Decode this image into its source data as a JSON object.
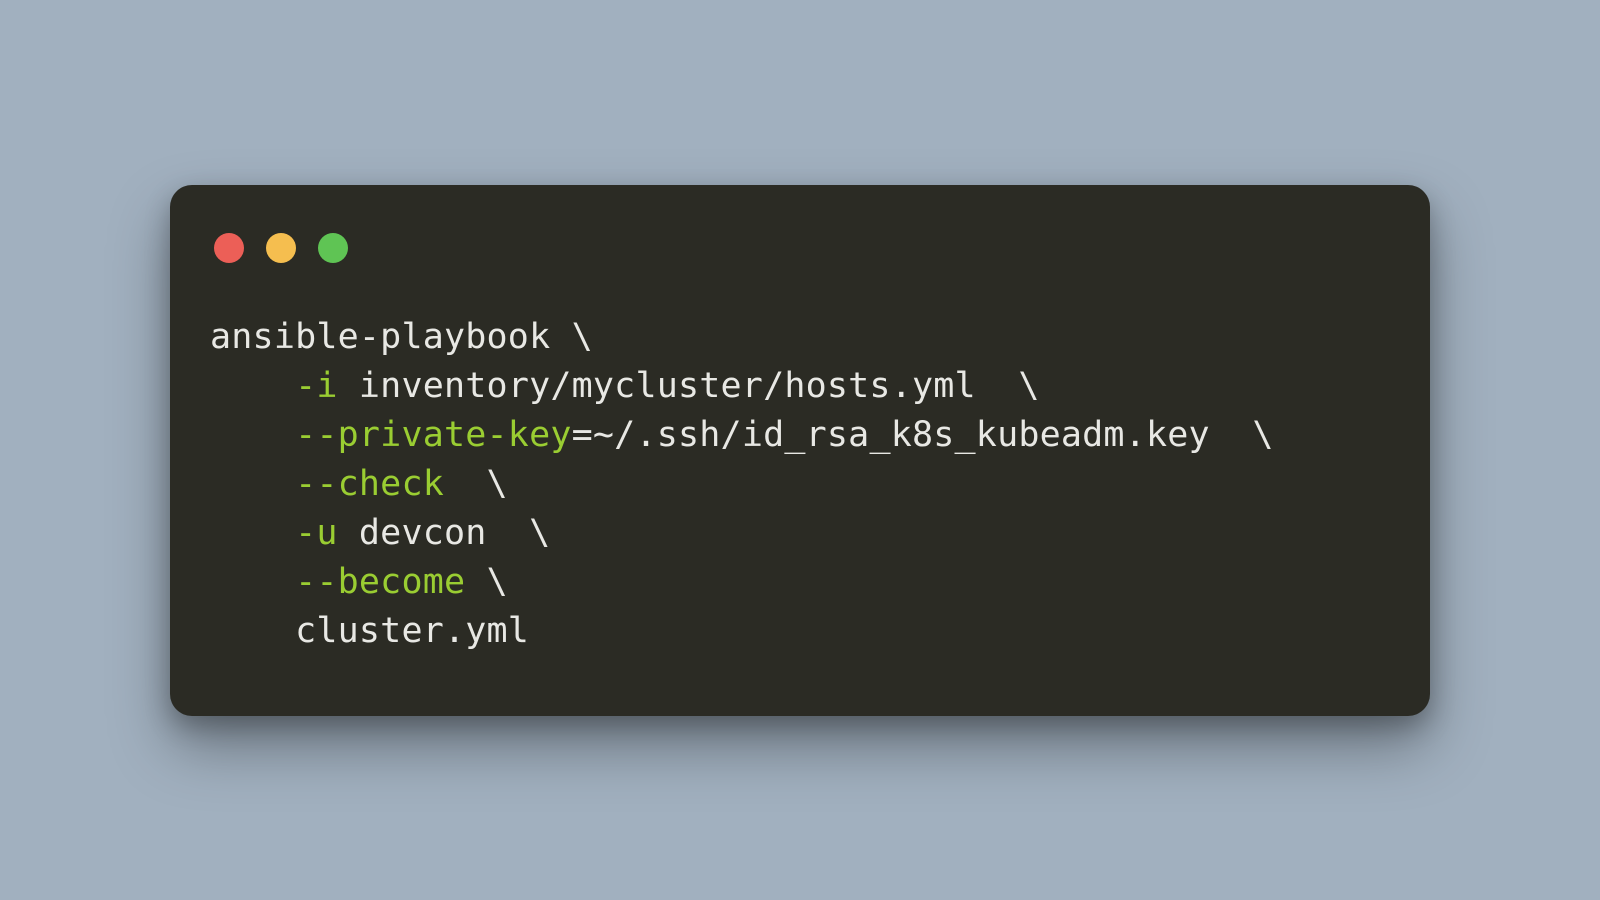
{
  "terminal": {
    "lines": {
      "l1_cmd": "ansible-playbook ",
      "cont": "\\",
      "indent": "    ",
      "l2_flag": "-i",
      "l2_rest": " inventory/mycluster/hosts.yml  ",
      "l3_flag": "--private-key",
      "l3_rest": "=~/.ssh/id_rsa_k8s_kubeadm.key  ",
      "l4_flag": "--check",
      "l4_rest": "  ",
      "l5_flag": "-u",
      "l5_rest": " devcon  ",
      "l6_flag": "--become",
      "l6_rest": " ",
      "l7": "cluster.yml"
    }
  },
  "colors": {
    "bg_page": "#a1b0bf",
    "bg_term": "#2b2b24",
    "text": "#e8e8e4",
    "flag": "#9acd32",
    "red": "#ec5f57",
    "yellow": "#f5be4f",
    "green": "#5fc454"
  }
}
